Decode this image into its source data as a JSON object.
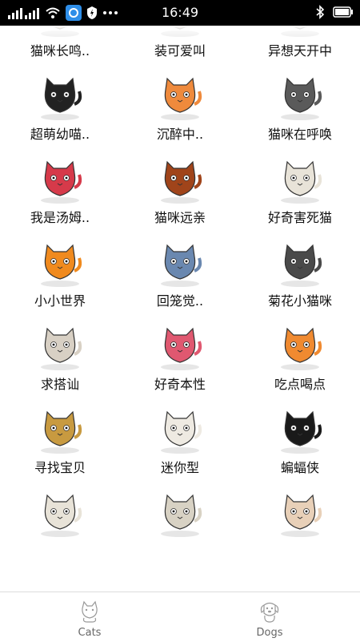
{
  "status_bar": {
    "time": "16:49"
  },
  "grid": {
    "rows": [
      [
        {
          "label": "猫咪长鸣..",
          "icon": "cat-sticker-icon",
          "color": "#f0a860"
        },
        {
          "label": "装可爱叫",
          "icon": "cat-sticker-icon",
          "color": "#c9a27a"
        },
        {
          "label": "异想天开中",
          "icon": "cat-sticker-icon",
          "color": "#d9c8b8"
        }
      ],
      [
        {
          "label": "超萌幼喵..",
          "icon": "black-cat-in-basket-icon",
          "color": "#222222"
        },
        {
          "label": "沉醉中..",
          "icon": "orange-cat-icon",
          "color": "#ef8a3c"
        },
        {
          "label": "猫咪在呼唤",
          "icon": "grey-cat-icon",
          "color": "#5a5a5a"
        }
      ],
      [
        {
          "label": "我是汤姆..",
          "icon": "cat-in-basket-icon",
          "color": "#d63a4a"
        },
        {
          "label": "猫咪远亲",
          "icon": "lion-icon",
          "color": "#a0441a"
        },
        {
          "label": "好奇害死猫",
          "icon": "cat-in-toilet-icon",
          "color": "#e8e3d8"
        }
      ],
      [
        {
          "label": "小小世界",
          "icon": "cat-in-pumpkin-icon",
          "color": "#f08a1e"
        },
        {
          "label": "回笼觉..",
          "icon": "cat-laptop-icon",
          "color": "#6a88b0"
        },
        {
          "label": "菊花小猫咪",
          "icon": "grey-cat-back-icon",
          "color": "#4a4a4a"
        }
      ],
      [
        {
          "label": "求搭讪",
          "icon": "cat-with-flower-icon",
          "color": "#d8d0c4"
        },
        {
          "label": "好奇本性",
          "icon": "cat-in-gift-box-icon",
          "color": "#e05870"
        },
        {
          "label": "吃点喝点",
          "icon": "cat-with-bowl-icon",
          "color": "#f08a30"
        }
      ],
      [
        {
          "label": "寻找宝贝",
          "icon": "cat-doghouse-icon",
          "color": "#c89a40"
        },
        {
          "label": "迷你型",
          "icon": "ghost-cat-icon",
          "color": "#eeeae2"
        },
        {
          "label": "蝙蝠侠",
          "icon": "bat-cat-icon",
          "color": "#1a1a1a"
        }
      ],
      [
        {
          "label": "",
          "icon": "cat-toilet-icon",
          "color": "#e8e3d8"
        },
        {
          "label": "",
          "icon": "mummy-cat-icon",
          "color": "#d8d2c4"
        },
        {
          "label": "",
          "icon": "cat-with-hearts-icon",
          "color": "#e8d0b8"
        }
      ]
    ]
  },
  "tabbar": {
    "tabs": [
      {
        "label": "Cats"
      },
      {
        "label": "Dogs"
      }
    ]
  }
}
